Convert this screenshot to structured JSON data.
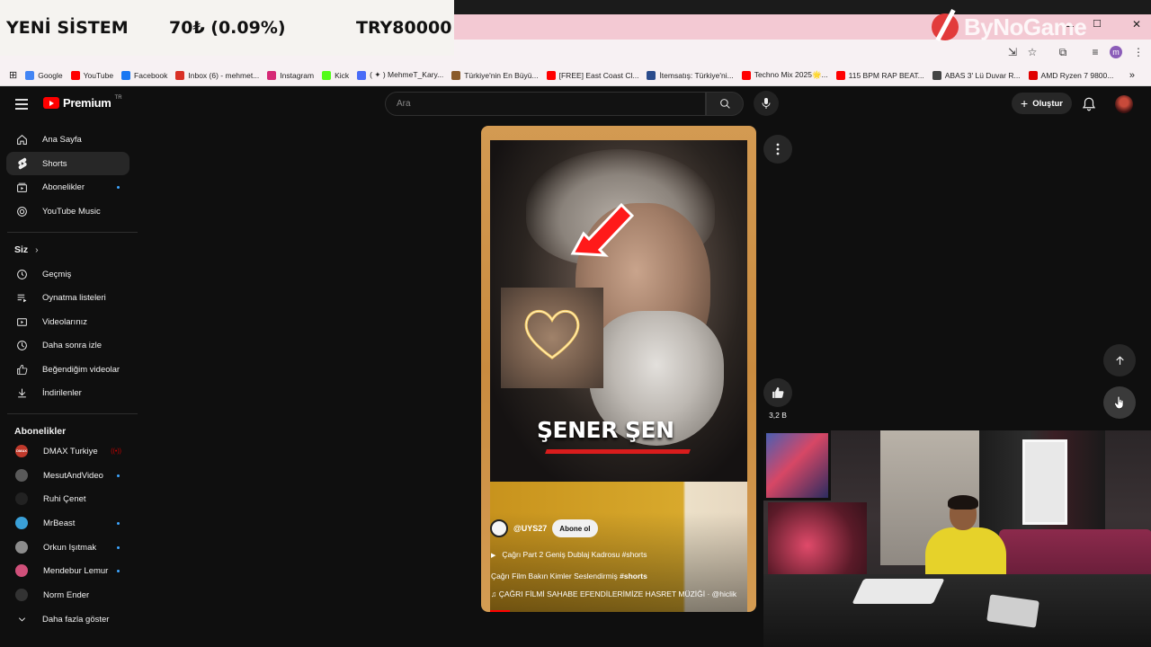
{
  "ticker": {
    "title": "YENİ SİSTEM",
    "change": "70₺ (0.09%)",
    "price": "TRY80000"
  },
  "watermark": {
    "text": "ByNoGame"
  },
  "window_controls": {
    "minimize": "–",
    "maximize": "☐",
    "close": "✕"
  },
  "bookmarks": [
    {
      "label": "Google",
      "color": "#4285f4"
    },
    {
      "label": "YouTube",
      "color": "#ff0000"
    },
    {
      "label": "Facebook",
      "color": "#1877f2"
    },
    {
      "label": "Inbox (6) - mehmet...",
      "color": "#d93025"
    },
    {
      "label": "Instagram",
      "color": "#d62976"
    },
    {
      "label": "Kick",
      "color": "#53fc18"
    },
    {
      "label": "( ✦ ) MehmeT_Kary...",
      "color": "#4a6cf7"
    },
    {
      "label": "Türkiye'nin En Büyü...",
      "color": "#8a5a2a"
    },
    {
      "label": "[FREE] East Coast Cl...",
      "color": "#ff0000"
    },
    {
      "label": "İtemsatış: Türkiye'ni...",
      "color": "#2b4c8c"
    },
    {
      "label": "Techno Mix 2025🌟...",
      "color": "#ff0000"
    },
    {
      "label": "115 BPM RAP BEAT...",
      "color": "#ff0000"
    },
    {
      "label": "ABAS 3' Lü Duvar R...",
      "color": "#444444"
    },
    {
      "label": "AMD Ryzen 7 9800...",
      "color": "#e00000"
    }
  ],
  "header": {
    "brand": "Premium",
    "country": "TR",
    "search_placeholder": "Ara",
    "create_label": "Oluştur"
  },
  "sidebar": {
    "main": [
      {
        "label": "Ana Sayfa",
        "icon": "home-icon"
      },
      {
        "label": "Shorts",
        "icon": "shorts-icon",
        "active": true
      },
      {
        "label": "Abonelikler",
        "icon": "subscriptions-icon",
        "dot": true
      },
      {
        "label": "YouTube Music",
        "icon": "music-icon"
      }
    ],
    "you_heading": "Siz",
    "you": [
      {
        "label": "Geçmiş",
        "icon": "history-icon"
      },
      {
        "label": "Oynatma listeleri",
        "icon": "playlist-icon"
      },
      {
        "label": "Videolarınız",
        "icon": "your-videos-icon"
      },
      {
        "label": "Daha sonra izle",
        "icon": "watch-later-icon"
      },
      {
        "label": "Beğendiğim videolar",
        "icon": "liked-icon"
      },
      {
        "label": "İndirilenler",
        "icon": "download-icon"
      }
    ],
    "subs_heading": "Abonelikler",
    "subscriptions": [
      {
        "label": "DMAX Turkiye",
        "color": "#c0392b",
        "live": true
      },
      {
        "label": "MesutAndVideo",
        "color": "#5a5a5a",
        "dot": true
      },
      {
        "label": "Ruhi Çenet",
        "color": "#222222"
      },
      {
        "label": "MrBeast",
        "color": "#3aa0d8",
        "dot": true
      },
      {
        "label": "Orkun Işıtmak",
        "color": "#8c8c8c",
        "dot": true
      },
      {
        "label": "Mendebur Lemur",
        "color": "#d0507a",
        "dot": true
      },
      {
        "label": "Norm Ender",
        "color": "#333333"
      }
    ],
    "show_more": "Daha fazla göster"
  },
  "short": {
    "overlay_name": "ŞENER ŞEN",
    "channel": "@UYS27",
    "subscribe": "Abone ol",
    "playlist": "Çağrı Part 2 Geniş Dublaj Kadrosu #shorts",
    "title_prefix": "Çağrı Film Bakın Kimler Seslendirmiş ",
    "title_tag": "#shorts",
    "music": "♫ ÇAĞRI FİLMİ SAHABE EFENDİLERİMİZE HASRET MÜZİĞİ · @hiclik",
    "likes": "3,2 B"
  }
}
